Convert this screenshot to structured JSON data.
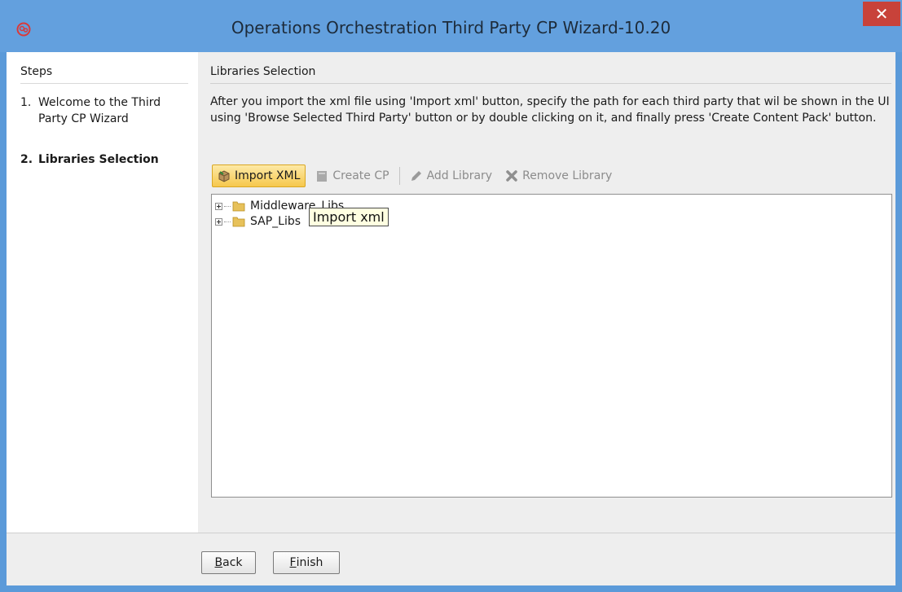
{
  "window": {
    "title": "Operations Orchestration Third Party CP Wizard-10.20",
    "close_glyph": "✕"
  },
  "steps": {
    "header": "Steps",
    "items": [
      {
        "num": "1.",
        "label": "Welcome to the Third Party CP Wizard",
        "active": false
      },
      {
        "num": "2.",
        "label": "Libraries Selection",
        "active": true
      }
    ]
  },
  "content": {
    "title": "Libraries Selection",
    "description": "After you import the xml file using 'Import xml' button, specify the path for each third party that wil be shown in the UI using 'Browse Selected Third Party' button or by double clicking on it, and finally press 'Create Content Pack' button."
  },
  "toolbar": {
    "import_label": "Import XML",
    "create_label": "Create CP",
    "add_label": "Add Library",
    "remove_label": "Remove Library"
  },
  "tree": {
    "items": [
      {
        "label": "Middleware_Libs"
      },
      {
        "label": "SAP_Libs"
      }
    ]
  },
  "tooltip": {
    "text": "Import xml"
  },
  "footer": {
    "back_prefix": "",
    "back_mnemonic": "B",
    "back_rest": "ack",
    "finish_mnemonic": "F",
    "finish_rest": "inish"
  },
  "colors": {
    "titlebar": "#63a0de",
    "close_button": "#c8423a",
    "active_button": "#f6c84d",
    "tooltip_bg": "#ffffe1"
  }
}
